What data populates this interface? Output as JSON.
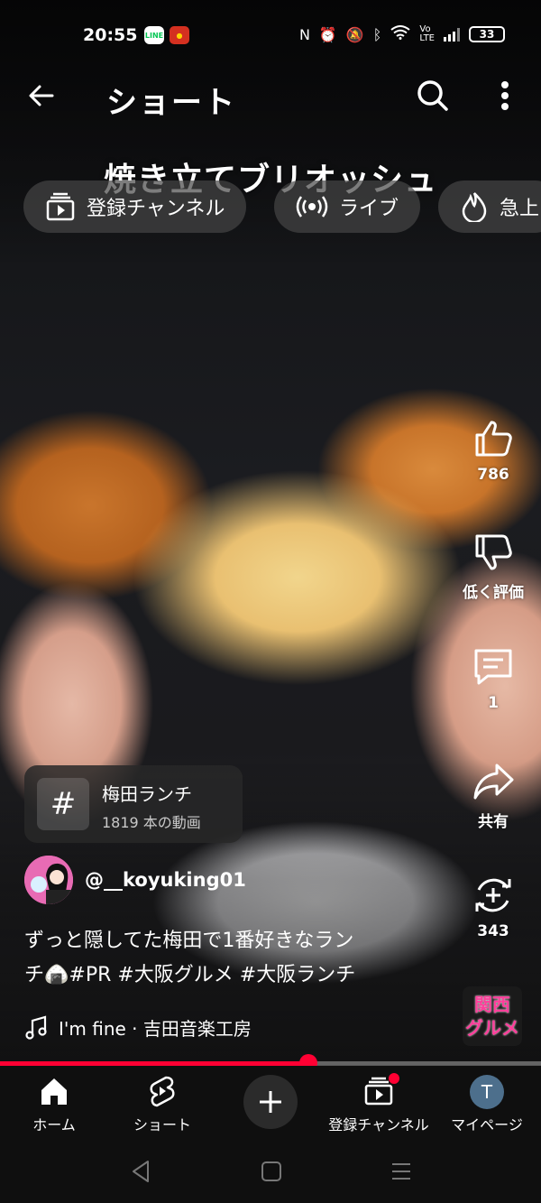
{
  "status_bar": {
    "time": "20:55",
    "line_icon_text": "LINE",
    "battery": "33"
  },
  "header": {
    "title": "ショート"
  },
  "video": {
    "caption": "焼き立てブリオッシュ"
  },
  "chips": [
    {
      "label": "登録チャンネル",
      "icon": "subscriptions-icon"
    },
    {
      "label": "ライブ",
      "icon": "live-icon"
    },
    {
      "label": "急上",
      "icon": "trending-icon"
    }
  ],
  "actions": {
    "like_count": "786",
    "dislike_label": "低く評価",
    "comment_count": "1",
    "share_label": "共有",
    "remix_count": "343"
  },
  "hashtag": {
    "symbol": "#",
    "name": "梅田ランチ",
    "count": "1819 本の動画"
  },
  "channel": {
    "handle": "@__koyuking01"
  },
  "description": {
    "line1": "ずっと隠してた梅田で1番好きなラン",
    "line2": "チ🍙#PR #大阪グルメ #大阪ランチ"
  },
  "music": {
    "track": "I'm fine · 吉田音楽工房"
  },
  "badge": {
    "line1": "関西",
    "line2": "グルメ"
  },
  "progress": {
    "fraction": 0.57
  },
  "bottom_nav": {
    "home": "ホーム",
    "shorts": "ショート",
    "subscriptions": "登録チャンネル",
    "mypage": "マイページ",
    "avatar_letter": "T"
  },
  "colors": {
    "accent": "#ff0033",
    "chip_bg": "#464646",
    "nav_bg": "#0f0f0f"
  }
}
